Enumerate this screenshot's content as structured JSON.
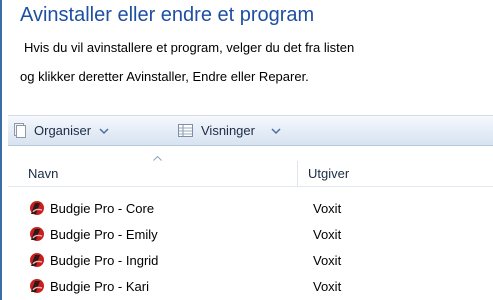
{
  "heading": {
    "title": "Avinstaller eller endre et program",
    "description_line1": "Hvis du vil avinstallere et program, velger du det fra listen",
    "description_line2": "og klikker deretter Avinstaller, Endre eller Reparer."
  },
  "toolbar": {
    "organise_label": "Organiser",
    "views_label": "Visninger"
  },
  "columns": {
    "name": "Navn",
    "publisher": "Utgiver"
  },
  "programs": [
    {
      "name": "Budgie Pro - Core",
      "publisher": "Voxit",
      "icon": "budgie-pro-icon"
    },
    {
      "name": "Budgie Pro - Emily",
      "publisher": "Voxit",
      "icon": "budgie-pro-icon"
    },
    {
      "name": "Budgie Pro - Ingrid",
      "publisher": "Voxit",
      "icon": "budgie-pro-icon"
    },
    {
      "name": "Budgie Pro - Kari",
      "publisher": "Voxit",
      "icon": "budgie-pro-icon"
    }
  ],
  "colors": {
    "title": "#1e50a2",
    "toolbar_top": "#f6f9fd",
    "toolbar_bottom": "#d8e3f1",
    "icon_red": "#c81e1e"
  }
}
